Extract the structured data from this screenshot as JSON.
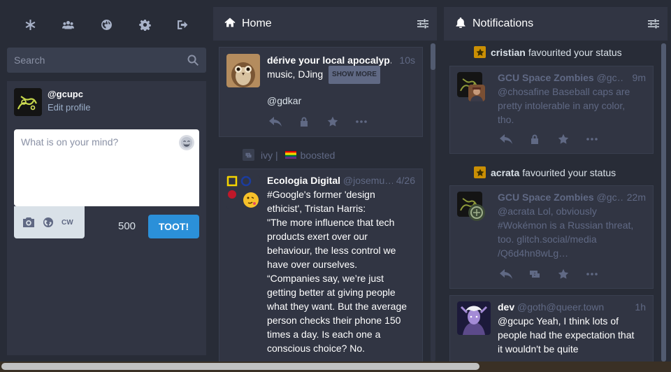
{
  "drawer": {
    "nav": [
      {
        "name": "getting-started",
        "icon": "asterisk-icon"
      },
      {
        "name": "local-timeline",
        "icon": "users-icon"
      },
      {
        "name": "federated-timeline",
        "icon": "globe-icon"
      },
      {
        "name": "preferences",
        "icon": "gear-icon"
      },
      {
        "name": "logout",
        "icon": "sign-out-icon"
      }
    ],
    "search": {
      "placeholder": "Search"
    },
    "account": {
      "handle": "@gcupc",
      "edit_profile": "Edit profile"
    },
    "compose": {
      "placeholder": "What is on your mind?",
      "cw_label": "CW",
      "char_count": "500",
      "toot_label": "TOOT!"
    }
  },
  "home": {
    "title": "Home",
    "statuses": [
      {
        "display_name": "dérive your local apocalyp…",
        "time": "10s",
        "spoiler": "music, DJing",
        "show_more": "SHOW MORE",
        "body": "@gdkar"
      }
    ],
    "boost": {
      "by": "ivy |",
      "label": "boosted"
    },
    "boosted_status": {
      "display_name": "Ecologia Digital",
      "acct": "@josemu…",
      "time": "4/26",
      "lines": [
        "#Google's former 'design",
        "ethicist', Tristan Harris:",
        "\"The more influence that tech",
        "products exert over our",
        "behaviour, the less control we",
        "have over ourselves.",
        "“Companies say, we’re just",
        "getting better at giving people",
        "what they want. But the average",
        "person checks their phone 150",
        "times a day. Is each one a",
        "conscious choice? No."
      ]
    }
  },
  "notifications": {
    "title": "Notifications",
    "items": [
      {
        "who": "cristian",
        "what": "favourited your status",
        "display_name": "GCU Space Zombies",
        "acct": "@gc…",
        "time": "9m",
        "lines": [
          "@chosafine Baseball caps are",
          "pretty intolerable in any color,",
          "tho."
        ]
      },
      {
        "who": "acrata",
        "what": "favourited your status",
        "display_name": "GCU Space Zombies",
        "acct": "@gc…",
        "time": "22m",
        "lines": [
          "@acrata Lol, obviously",
          "#Wokémon is a Russian threat,",
          "too. glitch.social/media",
          "/Q6d4hn8wLg…"
        ]
      },
      {
        "display_name": "dev",
        "acct": "@goth@queer.town",
        "time": "1h",
        "lines": [
          "@gcupc Yeah, I think lots of",
          "people had the expectation that",
          "it wouldn't be quite"
        ]
      }
    ]
  },
  "colors": {
    "background": "#282c37",
    "panel": "#313543",
    "accent": "#2b90d9",
    "favourite": "#ca8f04",
    "muted_text": "#606984"
  }
}
